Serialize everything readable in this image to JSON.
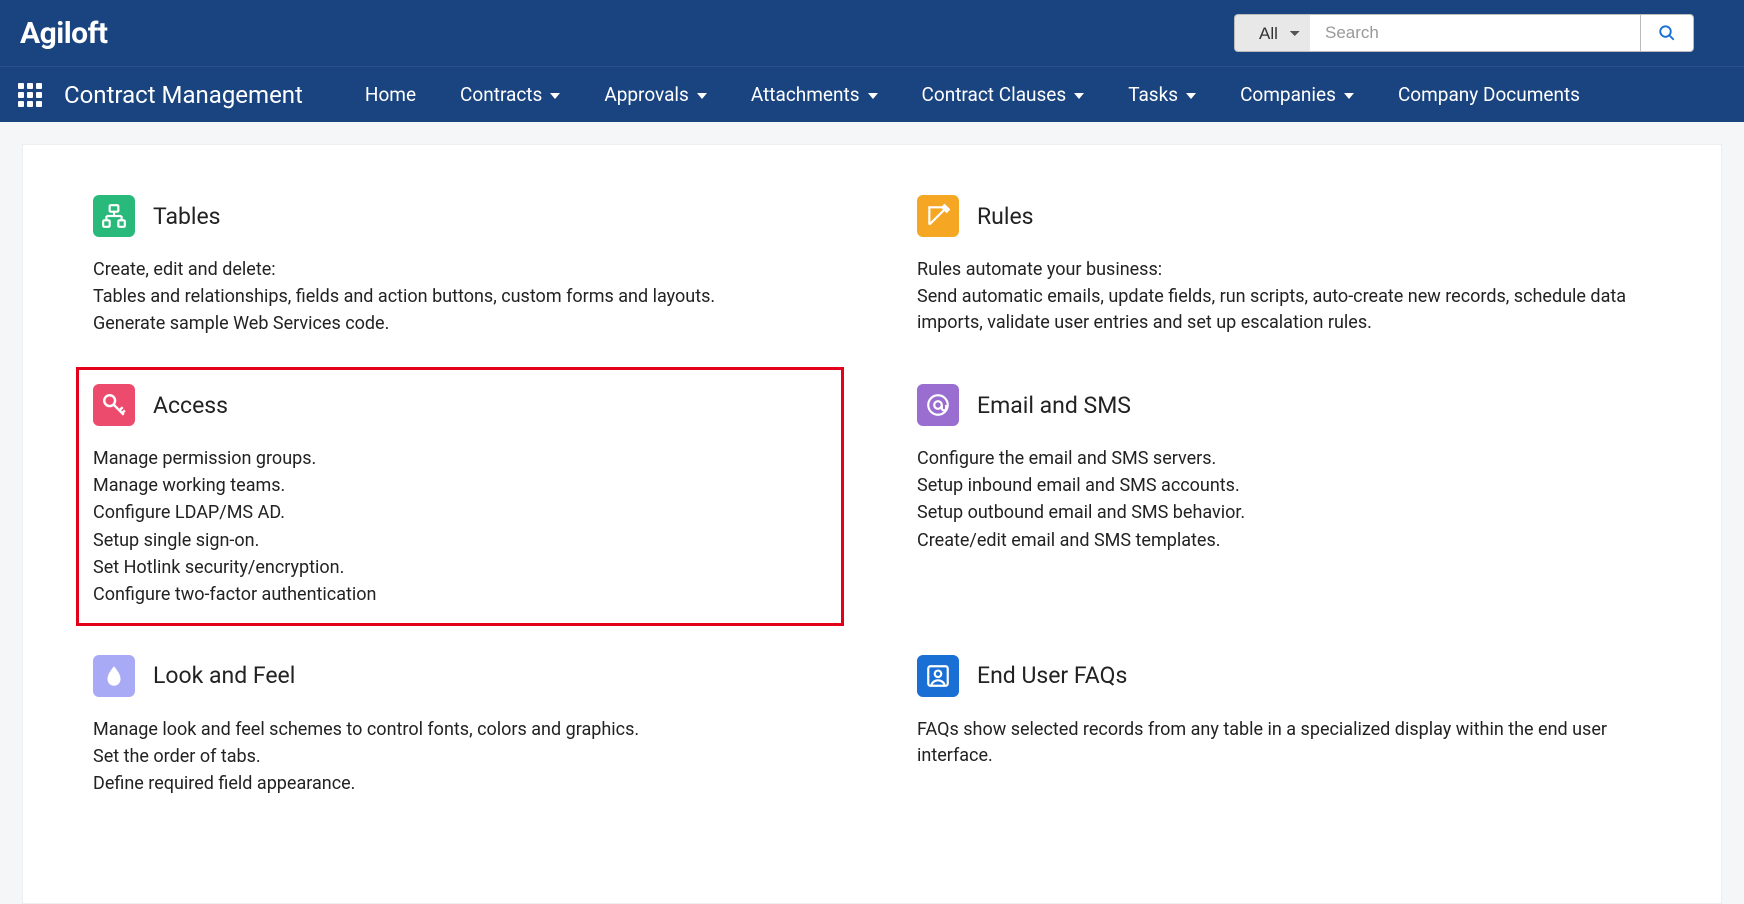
{
  "brand": "Agiloft",
  "search": {
    "category": "All",
    "placeholder": "Search"
  },
  "nav": {
    "module": "Contract Management",
    "items": [
      {
        "label": "Home",
        "dropdown": false
      },
      {
        "label": "Contracts",
        "dropdown": true
      },
      {
        "label": "Approvals",
        "dropdown": true
      },
      {
        "label": "Attachments",
        "dropdown": true
      },
      {
        "label": "Contract Clauses",
        "dropdown": true
      },
      {
        "label": "Tasks",
        "dropdown": true
      },
      {
        "label": "Companies",
        "dropdown": true
      },
      {
        "label": "Company Documents",
        "dropdown": false
      }
    ]
  },
  "cards": {
    "tables": {
      "title": "Tables",
      "lines": [
        "Create, edit and delete:",
        "Tables and relationships, fields and action buttons, custom forms and layouts.",
        "Generate sample Web Services code."
      ]
    },
    "rules": {
      "title": "Rules",
      "lines": [
        "Rules automate your business:",
        "Send automatic emails, update fields, run scripts, auto-create new records, schedule data imports, validate user entries and set up escalation rules."
      ]
    },
    "access": {
      "title": "Access",
      "lines": [
        "Manage permission groups.",
        "Manage working teams.",
        "Configure LDAP/MS AD.",
        "Setup single sign-on.",
        "Set Hotlink security/encryption.",
        "Configure two-factor authentication"
      ]
    },
    "email": {
      "title": "Email and SMS",
      "lines": [
        "Configure the email and SMS servers.",
        "Setup inbound email and SMS accounts.",
        "Setup outbound email and SMS behavior.",
        "Create/edit email and SMS templates."
      ]
    },
    "look": {
      "title": "Look and Feel",
      "lines": [
        "Manage look and feel schemes to control fonts, colors and graphics.",
        "Set the order of tabs.",
        "Define required field appearance."
      ]
    },
    "faqs": {
      "title": "End User FAQs",
      "lines": [
        "FAQs show selected records from any table in a specialized display within the end user interface."
      ]
    }
  }
}
